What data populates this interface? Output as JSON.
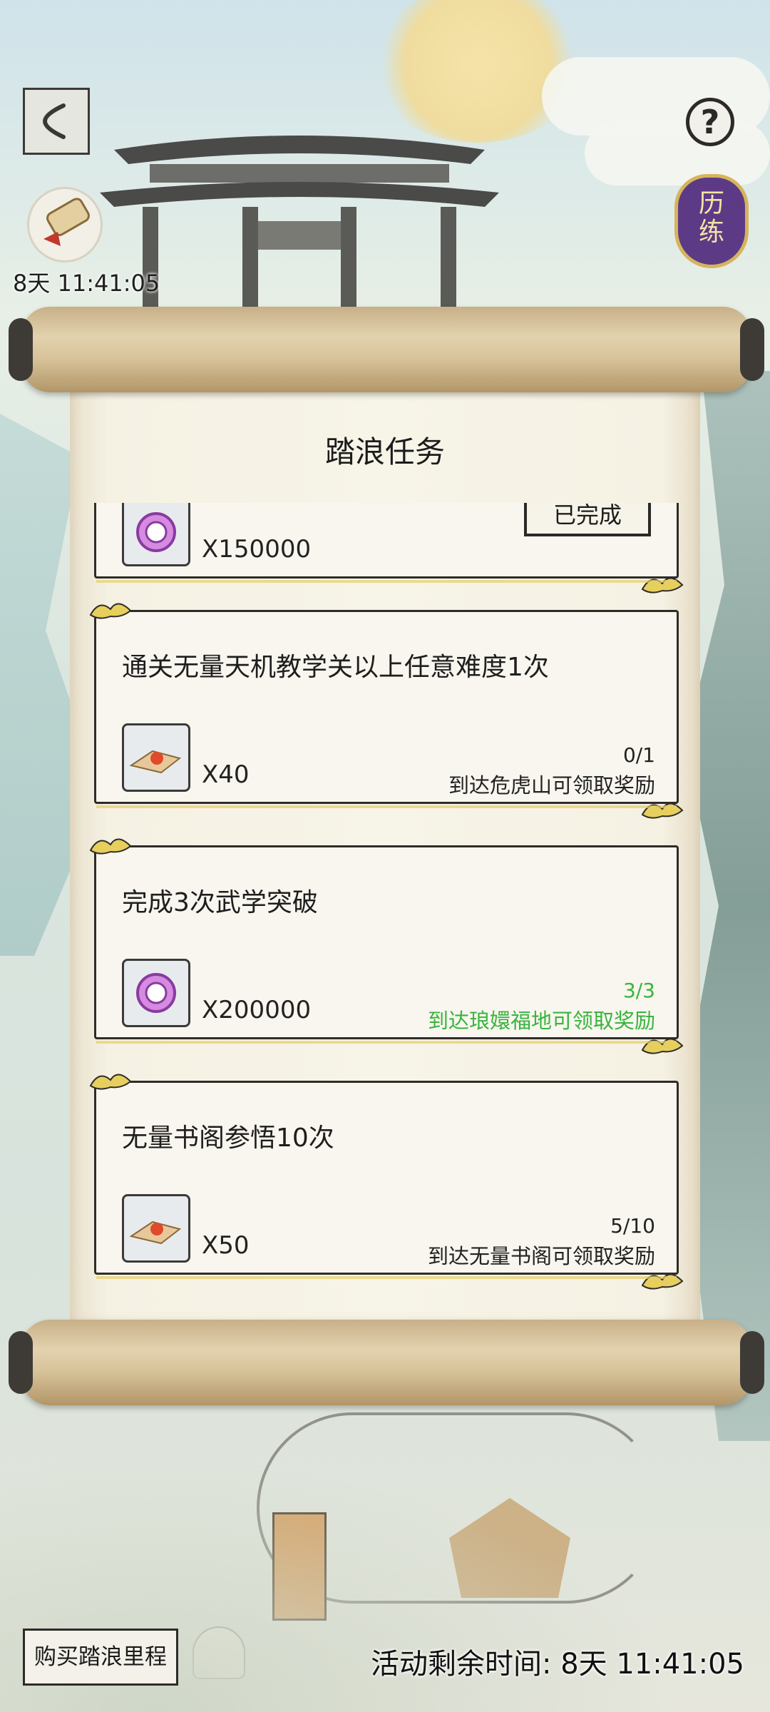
{
  "top": {
    "timer_left": "8天 11:41:05",
    "badge_text": "历练",
    "help_symbol": "?"
  },
  "panel": {
    "title": "踏浪任务",
    "tasks": [
      {
        "title": "",
        "reward_icon": "purple-token-icon",
        "reward_qty": "X150000",
        "button": "已完成"
      },
      {
        "title": "通关无量天机教学关以上任意难度1次",
        "reward_icon": "red-orb-cloth-icon",
        "reward_qty": "X40",
        "progress": "0/1",
        "status": "到达危虎山可领取奖励"
      },
      {
        "title": "完成3次武学突破",
        "reward_icon": "purple-token-icon",
        "reward_qty": "X200000",
        "progress": "3/3",
        "status": "到达琅嬛福地可领取奖励"
      },
      {
        "title": "无量书阁参悟10次",
        "reward_icon": "red-orb-cloth-icon",
        "reward_qty": "X50",
        "progress": "5/10",
        "status": "到达无量书阁可领取奖励"
      }
    ]
  },
  "bottom": {
    "buy_label": "购买踏浪里程",
    "remaining_label": "活动剩余时间:",
    "remaining_value": "8天 11:41:05"
  },
  "colors": {
    "done_green": "#39b43e",
    "badge_purple": "#5d3a86",
    "parchment": "#f7f4e8"
  }
}
